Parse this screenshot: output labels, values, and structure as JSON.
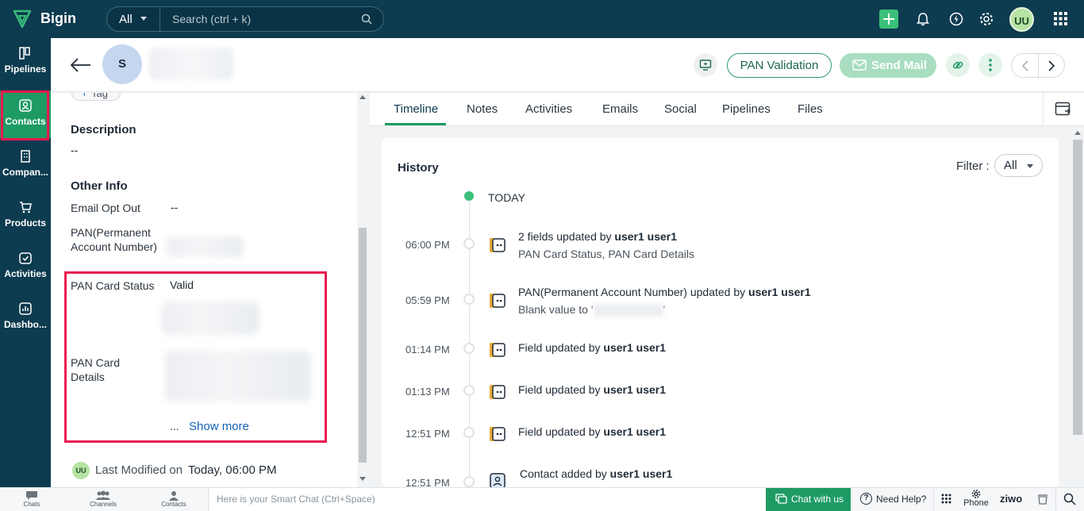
{
  "app": {
    "name": "Bigin"
  },
  "search": {
    "scope": "All",
    "placeholder": "Search (ctrl + k)"
  },
  "topbar": {
    "user_initials": "UU"
  },
  "nav": {
    "items": [
      {
        "label": "Pipelines",
        "icon": "pipelines-icon"
      },
      {
        "label": "Contacts",
        "icon": "contacts-icon",
        "active": true
      },
      {
        "label": "Compan...",
        "icon": "companies-icon"
      },
      {
        "label": "Products",
        "icon": "products-icon"
      },
      {
        "label": "Activities",
        "icon": "activities-icon"
      },
      {
        "label": "Dashbo...",
        "icon": "dashboards-icon"
      }
    ]
  },
  "contact": {
    "initial": "S"
  },
  "actions": {
    "pan_validation": "PAN Validation",
    "send_mail": "Send Mail"
  },
  "details": {
    "tag_label": "Tag",
    "description_title": "Description",
    "description_value": "--",
    "other_info_title": "Other Info",
    "email_opt_out_label": "Email Opt Out",
    "email_opt_out_value": "--",
    "pan_label": "PAN(Permanent Account Number)",
    "pan_status_label": "PAN Card Status",
    "pan_status_value": "Valid",
    "pan_details_label": "PAN Card Details",
    "ellipsis": "...",
    "show_more": "Show more",
    "last_modified_initials": "UU",
    "last_modified_label": "Last Modified on",
    "last_modified_value": "Today, 06:00 PM"
  },
  "tabs": [
    "Timeline",
    "Notes",
    "Activities",
    "Emails",
    "Social",
    "Pipelines",
    "Files"
  ],
  "history": {
    "title": "History",
    "filter_label": "Filter :",
    "filter_value": "All",
    "today_label": "TODAY",
    "entries": [
      {
        "time": "06:00 PM",
        "text": "2 fields updated by ",
        "user": "user1 user1",
        "sub": "PAN Card Status, PAN Card Details"
      },
      {
        "time": "05:59 PM",
        "text": "PAN(Permanent Account Number) updated by ",
        "user": "user1 user1",
        "sub": "Blank value to '",
        "sub_end": "'"
      },
      {
        "time": "01:14 PM",
        "text": "Field updated by ",
        "user": "user1 user1"
      },
      {
        "time": "01:13 PM",
        "text": "Field updated by ",
        "user": "user1 user1"
      },
      {
        "time": "12:51 PM",
        "text": "Field updated by ",
        "user": "user1 user1"
      },
      {
        "time": "12:51 PM",
        "text": "Contact added by ",
        "user": "user1 user1"
      }
    ]
  },
  "bottombar": {
    "chats": "Chats",
    "channels": "Channels",
    "contacts": "Contacts",
    "smart_chat_placeholder": "Here is your Smart Chat (Ctrl+Space)",
    "chat_with_us": "Chat with us",
    "need_help": "Need Help?",
    "phone": "Phone",
    "ziwo": "ziwo"
  },
  "colors": {
    "topbar": "#0d3b4f",
    "accent": "#1e9b64",
    "highlight": "#e8194f"
  }
}
